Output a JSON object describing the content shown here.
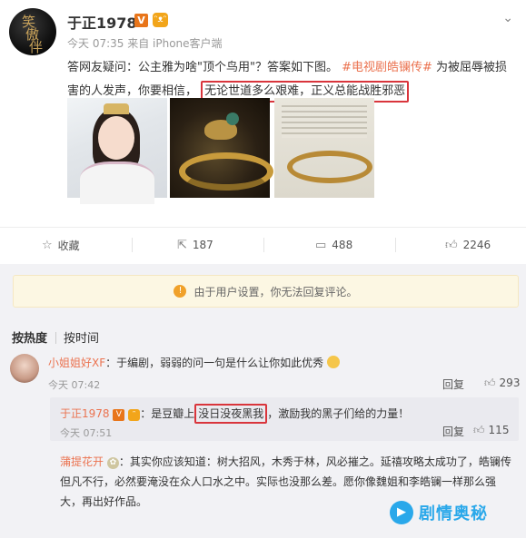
{
  "post": {
    "author": "于正1978",
    "v_badge": "V",
    "fan_badge": "ᵔᴥᵔ",
    "time_source": "今天 07:35 来自 iPhone客户端",
    "text_before_tag": "答网友疑问：公主雅为啥\"顶个鸟用\"？答案如下图。",
    "hashtag": "#电视剧皓镧传#",
    "text_after_tag": " 为被屈辱被损害的人发声，你要相信，",
    "highlight": "无论世道多么艰难，正义总能战胜邪恶",
    "avatar_chars": [
      "笑",
      "傲",
      "伴"
    ],
    "images": [
      "photo-princess",
      "photo-gold-bird-crown",
      "photo-book-artifact"
    ]
  },
  "actions": {
    "favorite": "收藏",
    "repost": "187",
    "comment": "488",
    "like": "2246"
  },
  "notice": {
    "text": "由于用户设置，你无法回复评论。"
  },
  "sort": {
    "hot": "按热度",
    "time": "按时间"
  },
  "comments": [
    {
      "name": "小姐姐好XF",
      "text": "：于编剧，弱弱的问一句是什么让你如此优秀",
      "time": "今天 07:42",
      "reply": "回复",
      "likes": "293"
    }
  ],
  "subreply": {
    "name": "于正1978",
    "text_before": "：是豆瓣上",
    "highlight": "没日没夜黑我",
    "text_after": "，激励我的黑子们给的力量！",
    "time": "今天 07:51",
    "reply": "回复",
    "likes": "115"
  },
  "comment2": {
    "name": "蒲提花开",
    "text": "：其实你应该知道：树大招风，木秀于林，风必摧之。延禧攻略太成功了，皓镧传但凡不行，必然要淹没在众人口水之中。实际也没那么差。愿你像魏姐和李皓镧一样那么强大，再出好作品。"
  },
  "watermark": {
    "text": "剧情奥秘"
  },
  "colors": {
    "accent_orange": "#eb7350",
    "highlight_red": "#d9353c",
    "watermark_blue": "#2aa8ea"
  }
}
